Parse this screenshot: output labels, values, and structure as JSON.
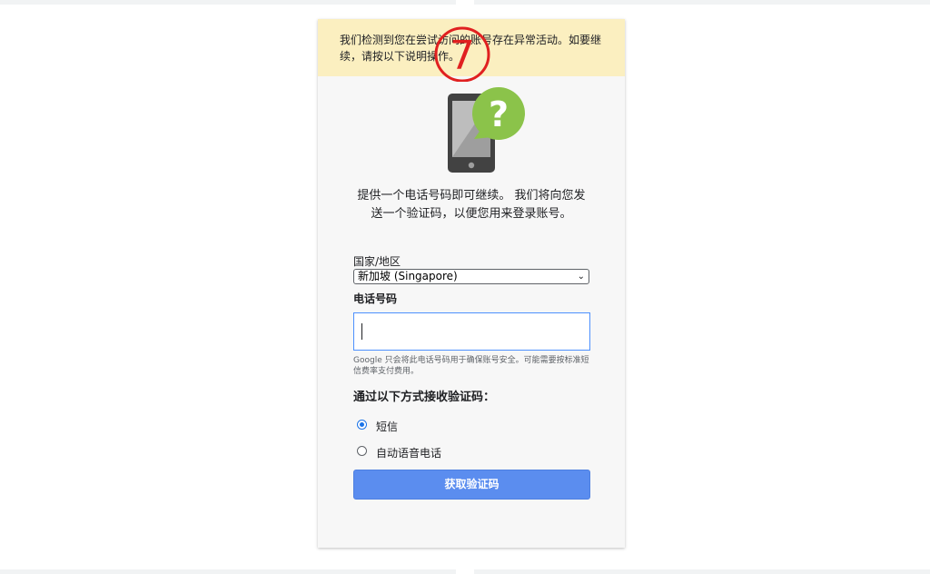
{
  "warning": {
    "text": "我们检测到您在尝试访问的账号存在异常活动。如要继续，请按以下说明操作。"
  },
  "step_marker": {
    "number": "7",
    "color": "#e02020"
  },
  "illustration": {
    "icon": "phone-question-icon",
    "question_mark": "?"
  },
  "intro": {
    "text": "提供一个电话号码即可继续。 我们将向您发送一个验证码，以便您用来登录账号。"
  },
  "form": {
    "country_label": "国家/地区",
    "country_value": "新加坡 (Singapore)",
    "phone_label": "电话号码",
    "phone_value": "",
    "disclaimer": "Google 只会将此电话号码用于确保账号安全。可能需要按标准短信费率支付费用。",
    "receive_label": "通过以下方式接收验证码：",
    "options": [
      {
        "label": "短信",
        "checked": true
      },
      {
        "label": "自动语音电话",
        "checked": false
      }
    ],
    "submit_label": "获取验证码"
  },
  "colors": {
    "warning_bg": "#fbefc0",
    "button_bg": "#5b8def",
    "radio_accent": "#1a73e8"
  }
}
